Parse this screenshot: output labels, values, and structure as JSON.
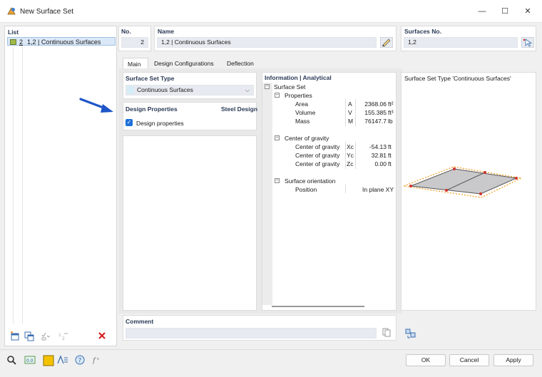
{
  "window": {
    "title": "New Surface Set",
    "minimize_glyph": "—",
    "maximize_glyph": "☐",
    "close_glyph": "✕"
  },
  "list": {
    "label": "List",
    "items": [
      {
        "number": "2",
        "text": "1,2 | Continuous Surfaces",
        "color": "#9fb94a"
      }
    ]
  },
  "header": {
    "no_label": "No.",
    "no_value": "2",
    "name_label": "Name",
    "name_value": "1,2 | Continuous Surfaces",
    "surfaces_label": "Surfaces No.",
    "surfaces_value": "1,2"
  },
  "tabs": [
    {
      "label": "Main",
      "active": true
    },
    {
      "label": "Design Configurations",
      "active": false
    },
    {
      "label": "Deflection",
      "active": false
    }
  ],
  "surface_set_type": {
    "label": "Surface Set Type",
    "value": "Continuous Surfaces"
  },
  "design_properties": {
    "label": "Design Properties",
    "right_label": "Steel Design",
    "checkbox_label": "Design properties",
    "checked": true
  },
  "info": {
    "label": "Information | Analytical",
    "root": "Surface Set",
    "groups": [
      {
        "name": "Properties",
        "rows": [
          {
            "name": "Area",
            "symbol": "A",
            "value": "2368.06",
            "unit": "ft²"
          },
          {
            "name": "Volume",
            "symbol": "V",
            "value": "155.385",
            "unit": "ft³"
          },
          {
            "name": "Mass",
            "symbol": "M",
            "value": "76147.7",
            "unit": "lb"
          }
        ]
      },
      {
        "name": "Center of gravity",
        "rows": [
          {
            "name": "Center of gravity",
            "symbol": "Xc",
            "value": "-54.13",
            "unit": "ft"
          },
          {
            "name": "Center of gravity",
            "symbol": "Yc",
            "value": "32.81",
            "unit": "ft"
          },
          {
            "name": "Center of gravity",
            "symbol": "Zc",
            "value": "0.00",
            "unit": "ft"
          }
        ]
      },
      {
        "name": "Surface orientation",
        "rows": [
          {
            "name": "Position",
            "symbol": "",
            "value": "In plane XY",
            "unit": ""
          }
        ]
      }
    ]
  },
  "preview": {
    "label": "Surface Set Type 'Continuous Surfaces'"
  },
  "comment": {
    "label": "Comment",
    "value": ""
  },
  "buttons": {
    "ok": "OK",
    "cancel": "Cancel",
    "apply": "Apply"
  },
  "colors": {
    "accent": "#1e6fd9",
    "arrow": "#1e55c8",
    "surface_fill": "#c9c9cc",
    "node": "#d0302a",
    "outline_dashed": "#f09a1c"
  }
}
